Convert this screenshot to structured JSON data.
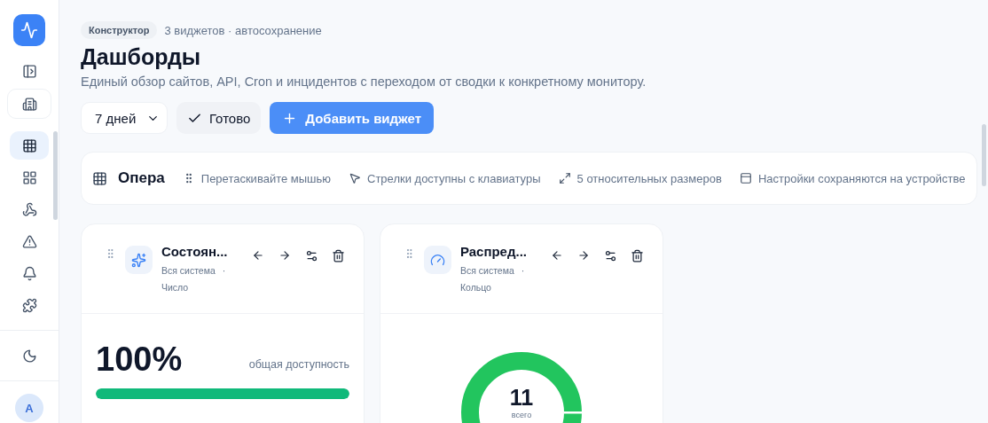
{
  "sidebar": {
    "items": [
      {
        "selected": false
      },
      {
        "selected": false
      },
      {
        "selected": true
      },
      {
        "selected": false
      },
      {
        "selected": false
      },
      {
        "selected": false
      },
      {
        "selected": false
      },
      {
        "selected": false
      }
    ],
    "avatar": "A"
  },
  "header": {
    "badge": "Конструктор",
    "meta": "3 виджетов · автосохранение",
    "title": "Дашборды",
    "subtitle": "Единый обзор сайтов, API, Cron и инцидентов с переходом от сводки к конкретному монитору."
  },
  "actions": {
    "period": "7 дней",
    "done": "Готово",
    "add": "Добавить виджет"
  },
  "toolbar": {
    "name": "Опера",
    "hints": [
      "Перетаскивайте мышью",
      "Стрелки доступны с клавиатуры",
      "5 относительных размеров",
      "Настройки сохраняются на устройстве"
    ]
  },
  "widgets": [
    {
      "kind": "number",
      "title": "Состоян...",
      "scope": "Вся система",
      "separator": "·",
      "type": "Число",
      "value": "100%",
      "caption": "общая доступность",
      "level": 1
    },
    {
      "kind": "donut",
      "title": "Распред...",
      "scope": "Вся система",
      "separator": "·",
      "type": "Кольцо",
      "value": "11",
      "caption": "всего"
    }
  ]
}
